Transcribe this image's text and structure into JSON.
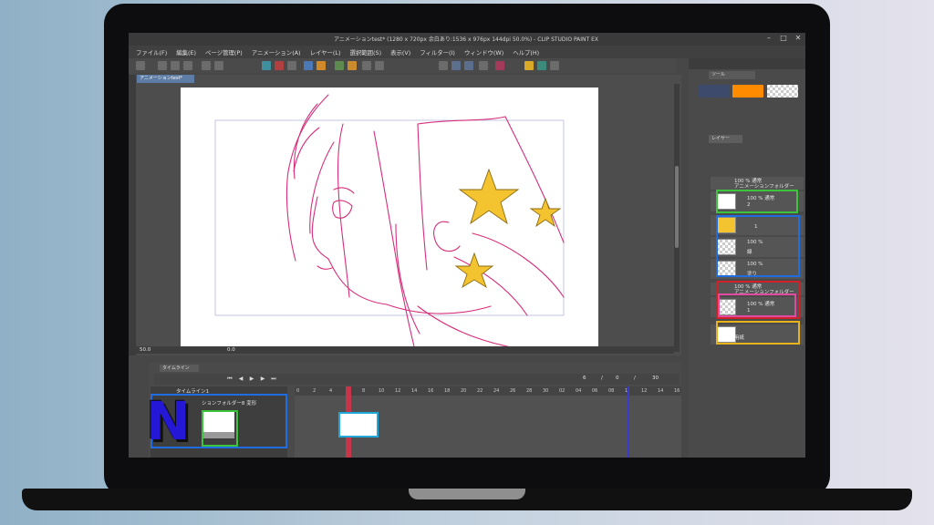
{
  "window": {
    "title": "アニメーションtest* (1280 x 720px 余白あり:1536 x 976px 144dpi 50.0%) - CLIP STUDIO PAINT EX",
    "controls": [
      "minimize-icon",
      "maximize-icon",
      "close-icon"
    ]
  },
  "menu": [
    "ファイル(F)",
    "編集(E)",
    "ページ管理(P)",
    "アニメーション(A)",
    "レイヤー(L)",
    "選択範囲(S)",
    "表示(V)",
    "フィルター(I)",
    "ウィンドウ(W)",
    "ヘルプ(H)"
  ],
  "document_tab": "アニメーションtest*",
  "status": {
    "zoom": "50.0",
    "rotation": "0.0"
  },
  "panel": {
    "tool_tab": "ツール",
    "layer_tab": "レイヤー",
    "colors": {
      "main": "#3d4a6b",
      "sub": "#ff8c00"
    },
    "layers": [
      {
        "label": "100 % 通常",
        "sub": "アニメーションフォルダー"
      },
      {
        "label": "100 % 通常",
        "sub": "2"
      },
      {
        "label": "1",
        "sub": ""
      },
      {
        "label": "100 %",
        "sub": "線"
      },
      {
        "label": "100 %",
        "sub": "塗り"
      },
      {
        "label": "100 % 通常",
        "sub": "アニメーションフォルダー"
      },
      {
        "label": "100 % 通常",
        "sub": "1"
      },
      {
        "label": "用紙",
        "sub": ""
      }
    ]
  },
  "timeline": {
    "tab": "タイムライン",
    "name": "タイムライン1",
    "track": "ションフォルダー8  変形",
    "counters": [
      "6",
      "/",
      "0",
      "/",
      "30"
    ],
    "ruler": [
      "0",
      "2",
      "4",
      "6",
      "8",
      "10",
      "12",
      "14",
      "16",
      "18",
      "20",
      "22",
      "24",
      "26",
      "28",
      "30",
      "02",
      "04",
      "06",
      "08",
      "1",
      "12",
      "14",
      "16"
    ]
  },
  "overlay": {
    "logo": "N"
  }
}
